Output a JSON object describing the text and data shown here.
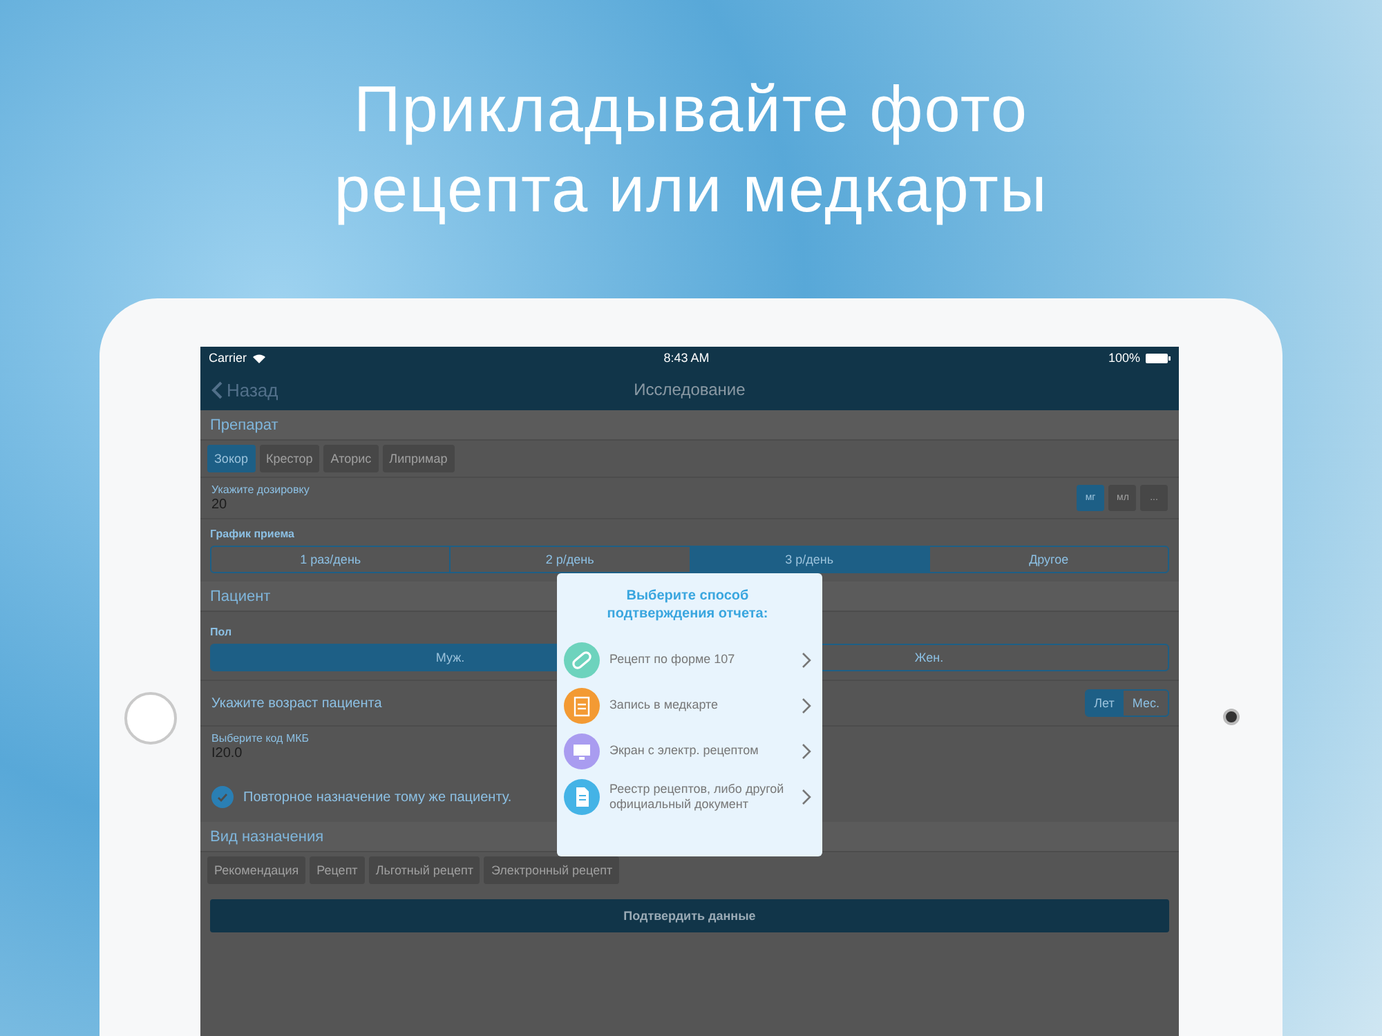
{
  "headline": "Прикладывайте фото рецепта или медкарты",
  "status_bar": {
    "carrier": "Carrier",
    "time": "8:43 AM",
    "battery": "100%"
  },
  "nav": {
    "back": "Назад",
    "title": "Исследование"
  },
  "drug": {
    "header": "Препарат",
    "chips": [
      {
        "label": "Зокор",
        "selected": true
      },
      {
        "label": "Крестор",
        "selected": false
      },
      {
        "label": "Аторис",
        "selected": false
      },
      {
        "label": "Липримар",
        "selected": false
      }
    ],
    "dose_label": "Укажите дозировку",
    "dose_value": "20",
    "units": [
      {
        "label": "мг",
        "selected": true
      },
      {
        "label": "мл",
        "selected": false
      },
      {
        "label": "...",
        "selected": false
      }
    ],
    "schedule_label": "График приема",
    "schedule": [
      {
        "label": "1 раз/день",
        "selected": false
      },
      {
        "label": "2 р/день",
        "selected": false
      },
      {
        "label": "3 р/день",
        "selected": true
      },
      {
        "label": "Другое",
        "selected": false
      }
    ]
  },
  "patient": {
    "header": "Пациент",
    "sex_label": "Пол",
    "sex": [
      {
        "label": "Муж.",
        "selected": true
      },
      {
        "label": "Жен.",
        "selected": false
      }
    ],
    "age_label": "Укажите возраст пациента",
    "age_units": [
      {
        "label": "Лет",
        "selected": true
      },
      {
        "label": "Мес.",
        "selected": false
      }
    ],
    "icd_label": "Выберите код МКБ",
    "icd_value": "I20.0",
    "repeat": {
      "label": "Повторное назначение тому же пациенту.",
      "checked": true
    }
  },
  "assignment": {
    "header": "Вид назначения",
    "chips": [
      {
        "label": "Рекомендация",
        "selected": false
      },
      {
        "label": "Рецепт",
        "selected": false
      },
      {
        "label": "Льготный рецепт",
        "selected": false
      },
      {
        "label": "Электронный рецепт",
        "selected": false
      }
    ]
  },
  "submit": "Подтвердить данные",
  "dialog": {
    "title": "Выберите способ подтверждения отчета:",
    "options": [
      {
        "kind": "pill",
        "color": "#6dd3bd",
        "label": "Рецепт по форме 107"
      },
      {
        "kind": "clipboard",
        "color": "#f39a33",
        "label": "Запись в медкарте"
      },
      {
        "kind": "monitor",
        "color": "#a99cf0",
        "label": "Экран с электр. рецептом"
      },
      {
        "kind": "document",
        "color": "#44b3e6",
        "label": "Реестр рецептов, либо другой официальный документ"
      }
    ]
  }
}
